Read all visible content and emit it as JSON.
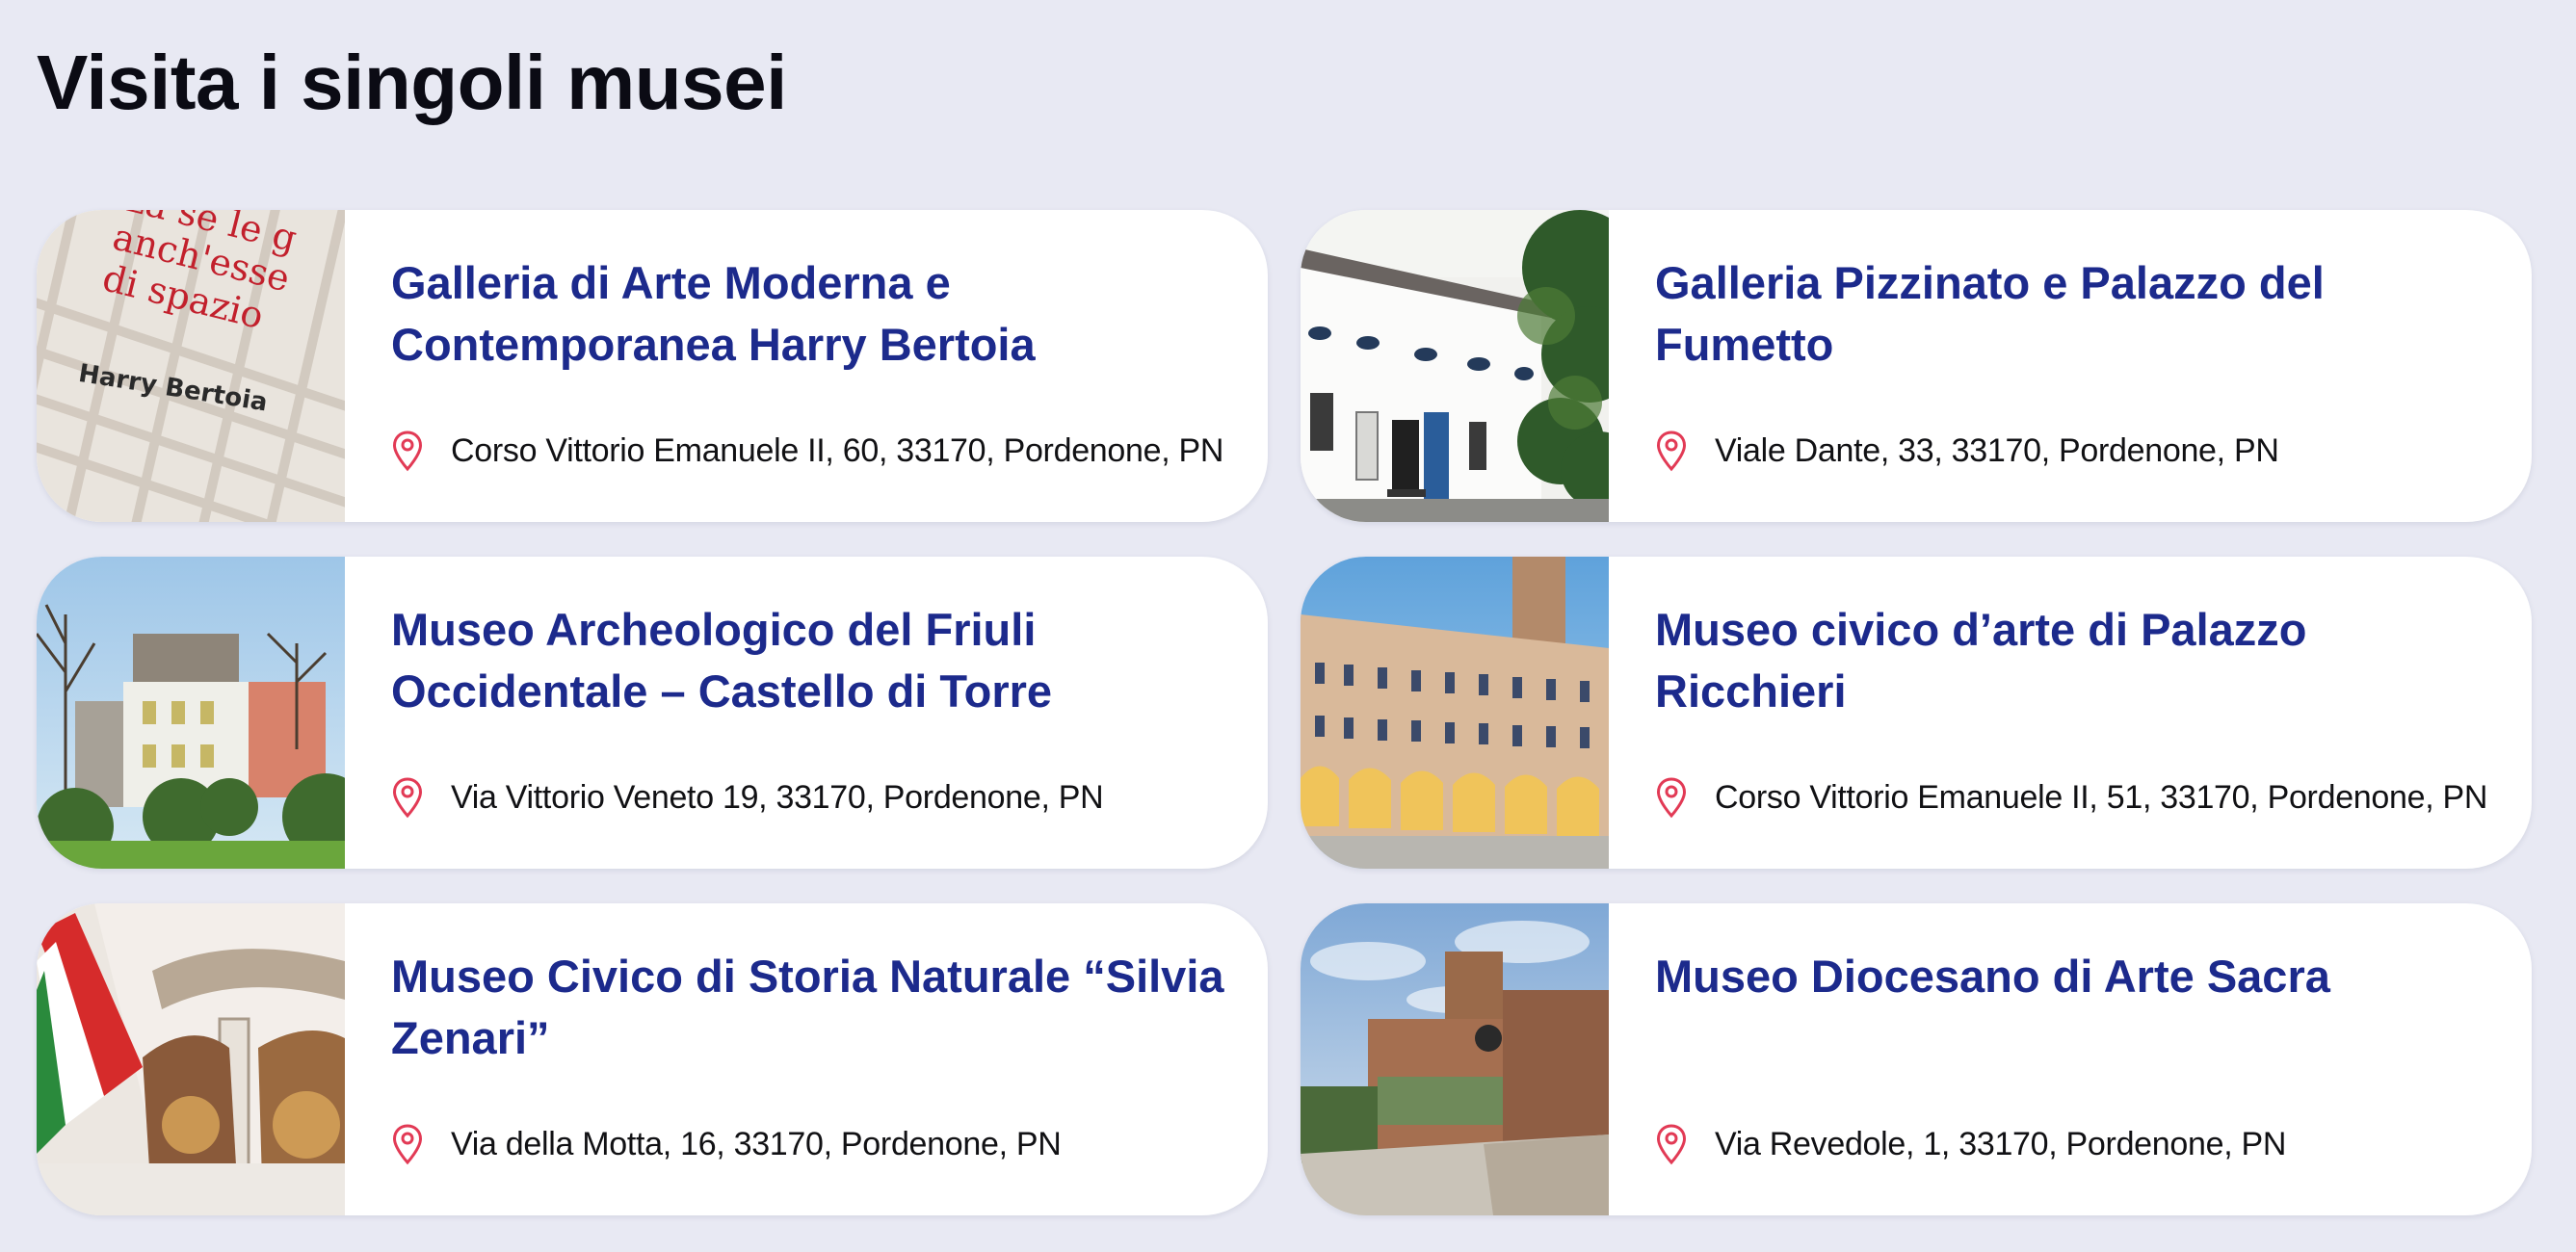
{
  "page": {
    "title": "Visita i singoli musei"
  },
  "colors": {
    "background": "#e8e9f3",
    "card_title": "#1c2a8c",
    "pin": "#e23a55"
  },
  "museums": [
    {
      "title": "Galleria di Arte Moderna e Contemporanea Harry Bertoia",
      "address": "Corso Vittorio Emanuele II, 60, 33170, Pordenone, PN",
      "icon": "map-pin-icon",
      "image_text": [
        "nza se le g",
        "anch'esse",
        "di spazio",
        "Harry Bertoia"
      ]
    },
    {
      "title": "Galleria Pizzinato e Palazzo del Fumetto",
      "address": "Viale Dante, 33, 33170, Pordenone, PN",
      "icon": "map-pin-icon"
    },
    {
      "title": "Museo Archeologico del Friuli Occidentale – Castello di Torre",
      "address": "Via Vittorio Veneto 19, 33170, Pordenone, PN",
      "icon": "map-pin-icon"
    },
    {
      "title": "Museo civico d’arte di Palazzo Ricchieri",
      "address": "Corso Vittorio Emanuele II, 51, 33170, Pordenone, PN",
      "icon": "map-pin-icon"
    },
    {
      "title": "Museo Civico di Storia Naturale “Silvia Zenari”",
      "address": "Via della Motta, 16, 33170, Pordenone, PN",
      "icon": "map-pin-icon"
    },
    {
      "title": "Museo Diocesano di Arte Sacra",
      "address": "Via Revedole, 1, 33170, Pordenone, PN",
      "icon": "map-pin-icon"
    }
  ]
}
